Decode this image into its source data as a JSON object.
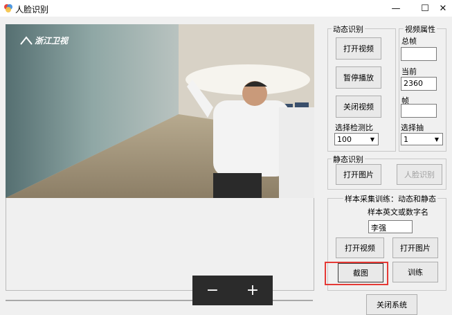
{
  "window": {
    "title": "人脸识别",
    "min_glyph": "—",
    "max_glyph": "☐",
    "close_glyph": "✕"
  },
  "video": {
    "channel_logo": "浙江卫视"
  },
  "zoom": {
    "minus": "−",
    "plus": "+"
  },
  "dynamic": {
    "legend": "动态识别",
    "open_video": "打开视频",
    "pause": "暂停播放",
    "close_video": "关闭视频",
    "ratio_label": "选择检测比",
    "ratio_value": "100"
  },
  "props": {
    "legend": "视频属性",
    "total_label": "总帧",
    "total_value": "",
    "current_label": "当前",
    "current_value": "2360",
    "frame_label": "帧",
    "frame_value": "",
    "skip_label": "选择抽",
    "skip_value": "1"
  },
  "static": {
    "legend": "静态识别",
    "open_image": "打开图片",
    "recognize": "人脸识别"
  },
  "sample": {
    "legend": "样本采集训练：动态和静态",
    "name_label": "样本英文或数字名",
    "name_value": "李强",
    "open_video": "打开视频",
    "open_image": "打开图片",
    "capture": "截图",
    "train": "训练"
  },
  "close_system": "关闭系统"
}
